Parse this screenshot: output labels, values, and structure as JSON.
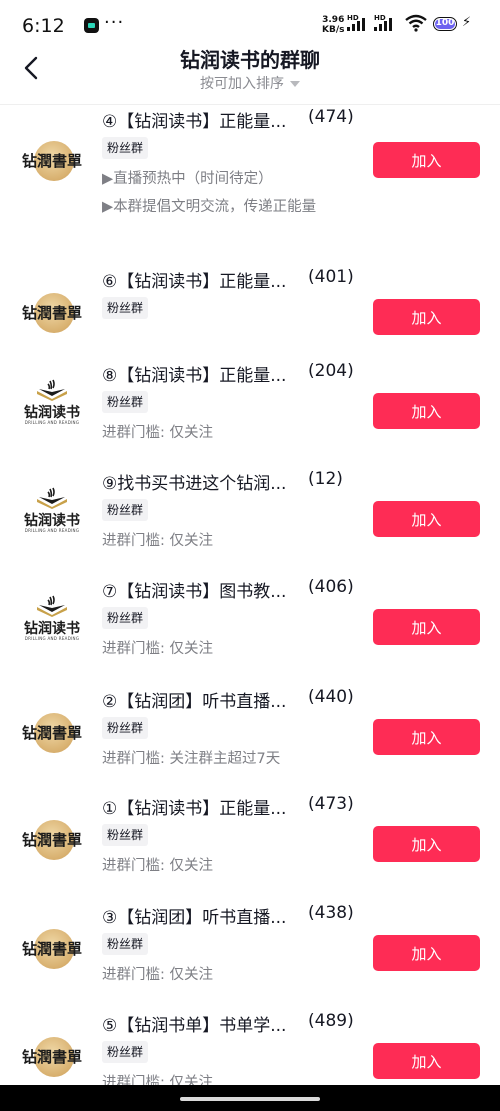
{
  "status_bar": {
    "time": "6:12",
    "dots": "···",
    "speed_value": "3.96",
    "speed_unit": "KB/s",
    "hd1": "HD",
    "hd2": "HD",
    "battery": "100",
    "app_icon_color": "#2bd6b8",
    "battery_color": "#6d63f0"
  },
  "header": {
    "title": "钻润读书的群聊",
    "sort_label": "按可加入排序"
  },
  "theme": {
    "accent": "#fe2c55",
    "tag_bg": "#f2f2f4",
    "muted_text": "#7e7f85"
  },
  "groups": [
    {
      "logo": "钻潤書單",
      "logo_style": "seal",
      "name": "④【钻润读书】正能量...",
      "count": "(474)",
      "tag": "粉丝群",
      "desc": [
        "▶直播预热中（时间待定）",
        "▶本群提倡文明交流，传递正能量"
      ],
      "join": "加入"
    },
    {
      "logo": "钻潤書單",
      "logo_style": "seal",
      "name": "⑥【钻润读书】正能量...",
      "count": "(401)",
      "tag": "粉丝群",
      "desc": [],
      "join": "加入"
    },
    {
      "logo": "钻润读书",
      "logo_sub": "DRILLING AND READING",
      "logo_style": "book",
      "name": "⑧【钻润读书】正能量...",
      "count": "(204)",
      "tag": "粉丝群",
      "desc": [
        "进群门槛: 仅关注"
      ],
      "join": "加入"
    },
    {
      "logo": "钻润读书",
      "logo_sub": "DRILLING AND READING",
      "logo_style": "book",
      "name": "⑨找书买书进这个钻润...",
      "count": "(12)",
      "tag": "粉丝群",
      "desc": [
        "进群门槛: 仅关注"
      ],
      "join": "加入"
    },
    {
      "logo": "钻润读书",
      "logo_sub": "DRILLING AND READING",
      "logo_style": "book",
      "name": "⑦【钻润读书】图书教...",
      "count": "(406)",
      "tag": "粉丝群",
      "desc": [
        "进群门槛: 仅关注"
      ],
      "join": "加入"
    },
    {
      "logo": "钻潤書單",
      "logo_style": "seal",
      "name": "②【钻润团】听书直播...",
      "count": "(440)",
      "tag": "粉丝群",
      "desc": [
        "进群门槛: 关注群主超过7天"
      ],
      "join": "加入"
    },
    {
      "logo": "钻潤書單",
      "logo_style": "seal",
      "name": "①【钻润读书】正能量...",
      "count": "(473)",
      "tag": "粉丝群",
      "desc": [
        "进群门槛: 仅关注"
      ],
      "join": "加入"
    },
    {
      "logo": "钻潤書單",
      "logo_style": "seal",
      "name": "③【钻润团】听书直播...",
      "count": "(438)",
      "tag": "粉丝群",
      "desc": [
        "进群门槛: 仅关注"
      ],
      "join": "加入"
    },
    {
      "logo": "钻潤書單",
      "logo_style": "seal",
      "name": "⑤【钻润书单】书单学...",
      "count": "(489)",
      "tag": "粉丝群",
      "desc": [
        "进群门槛: 仅关注"
      ],
      "join": "加入"
    }
  ]
}
